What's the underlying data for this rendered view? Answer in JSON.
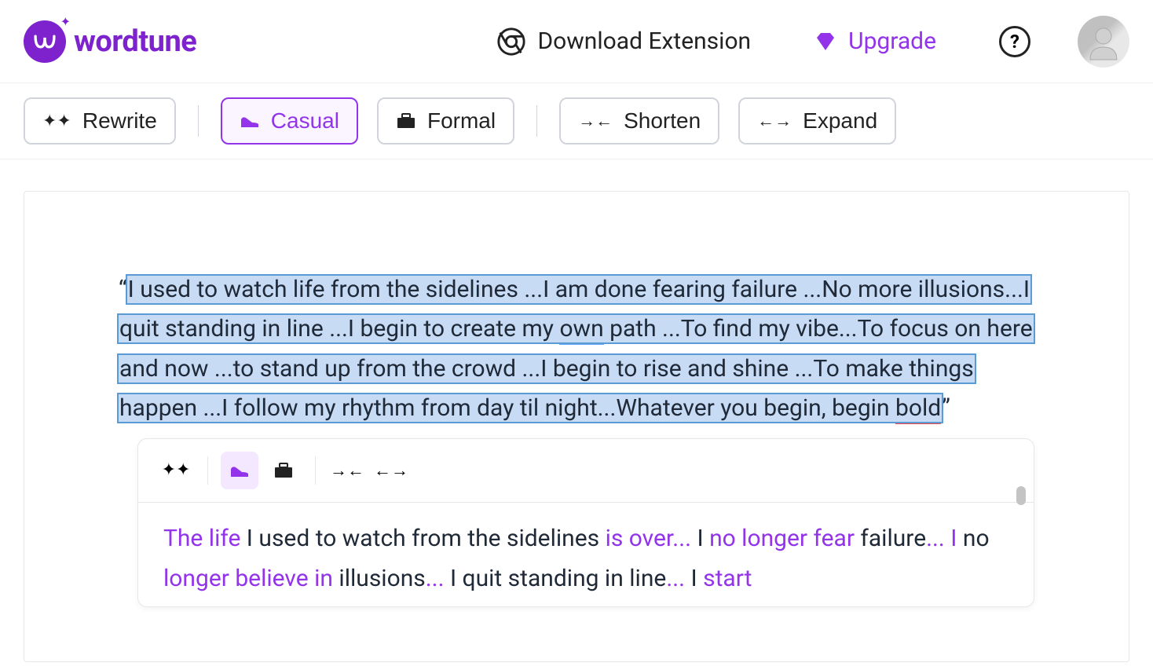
{
  "brand": {
    "name": "wordtune"
  },
  "header": {
    "download_label": "Download Extension",
    "upgrade_label": "Upgrade",
    "help_label": "?"
  },
  "toolbar": {
    "rewrite": "Rewrite",
    "casual": "Casual",
    "formal": "Formal",
    "shorten": "Shorten",
    "expand": "Expand"
  },
  "editor": {
    "open_quote": "“",
    "selected_text": "I used to watch life from the sidelines ...I am done fearing failure ...No more illusions...I quit standing in line ...I begin to create my ",
    "spell_own": "own",
    "selected_text_2": " path ...To find my vibe...To focus on here and now ...to stand up from the crowd ...I begin to rise and shine ...To make things happen ...I follow my rhythm from day til night...Whatever you begin, begin ",
    "spell_bold": "bold",
    "close_quote": "”"
  },
  "suggestion": {
    "parts": {
      "p1": "The life",
      "p2": " I used to watch from the sidelines ",
      "p3": "is over...",
      "p4": " I ",
      "p5": "no longer fear",
      "p6": " failure",
      "p7": "... I",
      "p8": " no ",
      "p9": "longer believe in",
      "p10": " illusions",
      "p11": "...",
      "p12": " I quit standing in line",
      "p13": "...",
      "p14": " I ",
      "p15": "start"
    }
  }
}
